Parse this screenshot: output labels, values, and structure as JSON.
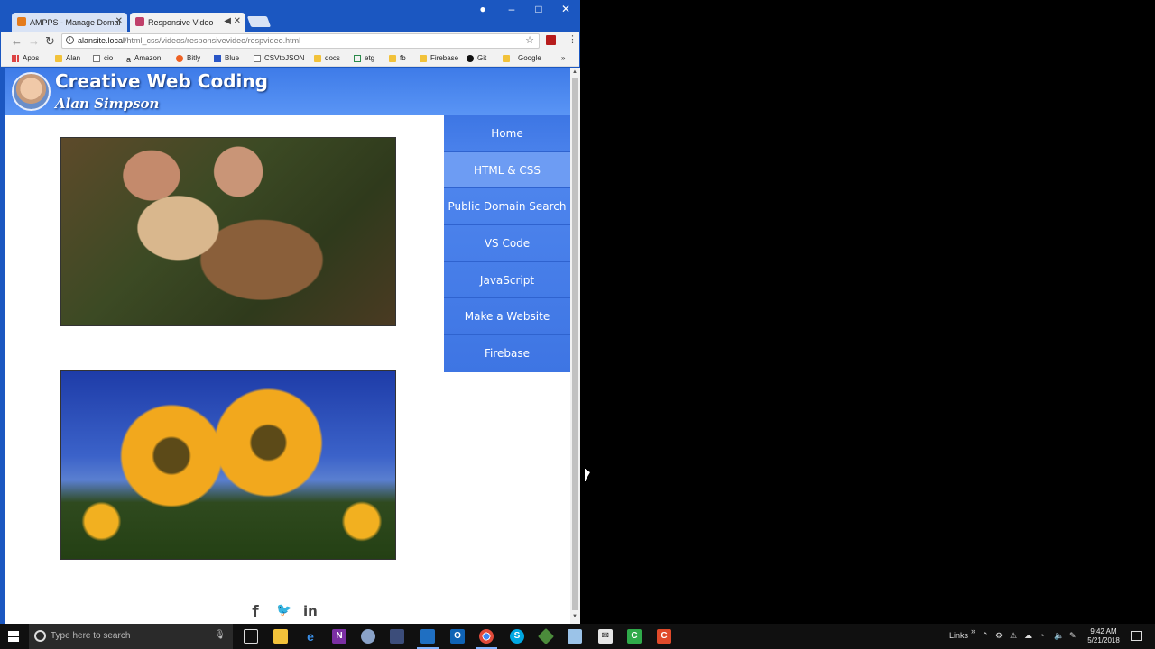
{
  "browser": {
    "tabs": [
      {
        "title": "AMPPS - Manage Domai",
        "active": false
      },
      {
        "title": "Responsive Video",
        "active": true
      }
    ],
    "controls": {
      "minimize": "–",
      "maximize": "□",
      "close": "✕"
    },
    "address": {
      "host": "alansite.local",
      "path": "/html_css/videos/responsivevideo/respvideo.html"
    },
    "bookmarks": [
      "Apps",
      "Alan",
      "cio",
      "Amazon",
      "Bitly",
      "Blue",
      "CSVtoJSON",
      "docs",
      "etg",
      "fb",
      "Firebase",
      "Git",
      "Google"
    ],
    "overflow": "»"
  },
  "site": {
    "title": "Creative Web Coding",
    "subtitle": "Alan Simpson",
    "nav": [
      "Home",
      "HTML & CSS",
      "Public Domain Search",
      "VS Code",
      "JavaScript",
      "Make a Website",
      "Firebase"
    ],
    "active_nav": "HTML & CSS",
    "social": {
      "facebook": "f",
      "twitter": "🐦",
      "linkedin": "in"
    }
  },
  "taskbar": {
    "search_placeholder": "Type here to search",
    "links_label": "Links",
    "time": "9:42 AM",
    "date": "5/21/2018"
  }
}
